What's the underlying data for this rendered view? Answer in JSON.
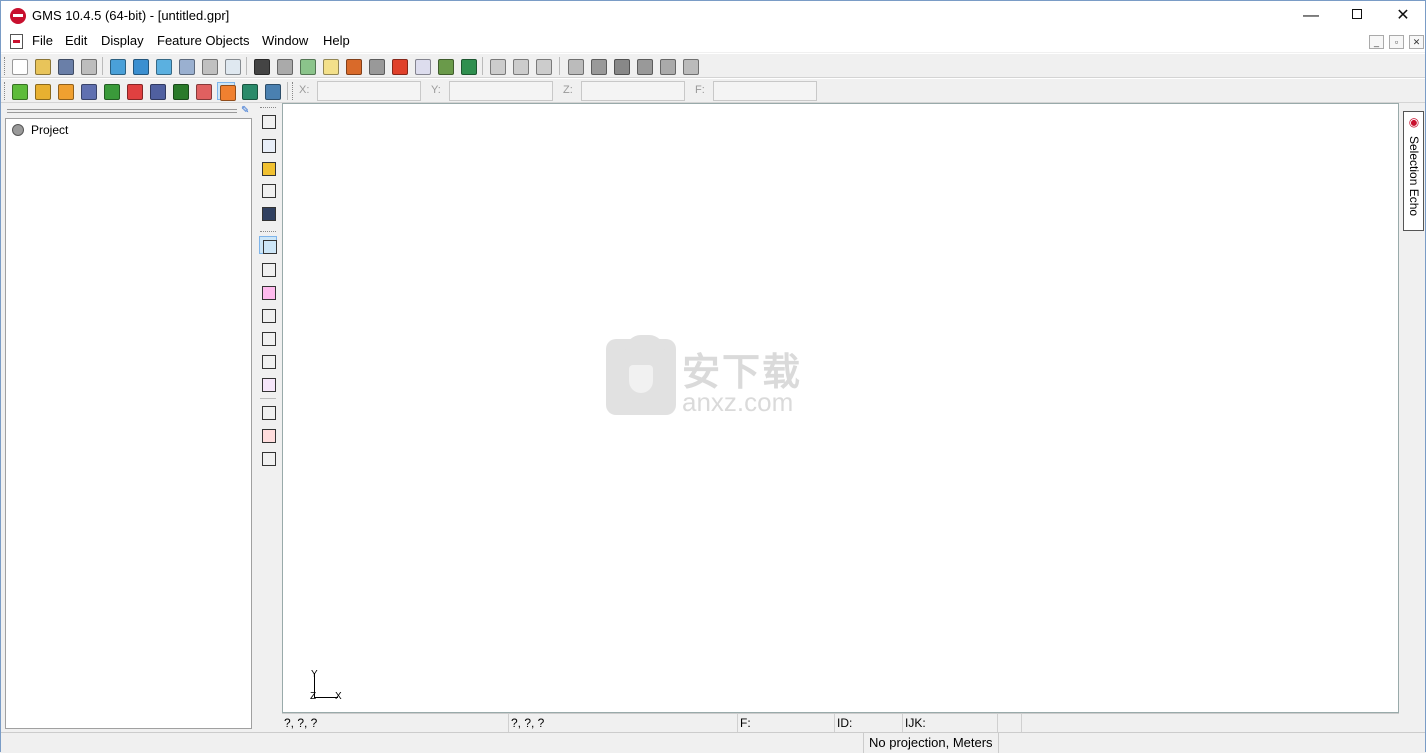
{
  "window": {
    "title": "GMS 10.4.5 (64-bit) - [untitled.gpr]"
  },
  "caption": {
    "minimize": "—",
    "maximize": "",
    "close": "✕"
  },
  "menu": {
    "items": [
      "File",
      "Edit",
      "Display",
      "Feature Objects",
      "Window",
      "Help"
    ]
  },
  "mdi": {
    "minimize": "_",
    "restore": "▫",
    "close": "✕"
  },
  "toolbar1": {
    "icons": [
      "new-file-icon",
      "open-folder-icon",
      "save-icon",
      "print-icon",
      "front-view-icon",
      "side-view-icon",
      "top-view-icon",
      "oblique-view-icon",
      "rotate-view-icon",
      "zoom-icon",
      "display-options-icon",
      "lock-icon",
      "refresh-icon",
      "light-icon",
      "chart-icon",
      "contour-icon",
      "color-ramp-icon",
      "spreadsheet-icon",
      "add-layers-icon",
      "globe-icon",
      "frame-icon",
      "frame-selected-icon",
      "frame-all-icon",
      "map-tool-icon",
      "map-coverage-icon",
      "map-feature-icon",
      "map-convert-icon",
      "map-grid-icon",
      "map-mesh-icon"
    ]
  },
  "toolbar2": {
    "icons": [
      "tin-module-icon",
      "borehole-module-icon",
      "solid-module-icon",
      "mesh-2d-module-icon",
      "grid-2d-module-icon",
      "scatter-2d-module-icon",
      "mesh-3d-module-icon",
      "grid-3d-module-icon",
      "scatter-3d-module-icon",
      "map-module-icon",
      "gis-module-icon",
      "uGrid-module-icon"
    ],
    "coords": [
      {
        "label": "X:",
        "value": ""
      },
      {
        "label": "Y:",
        "value": ""
      },
      {
        "label": "Z:",
        "value": ""
      },
      {
        "label": "F:",
        "value": ""
      }
    ]
  },
  "tree": {
    "root_label": "Project"
  },
  "tools": {
    "icons": [
      "pan-icon",
      "zoom-tool-icon",
      "rotate-tool-icon",
      "measure-icon",
      "frame-tool-icon",
      "select-arrow-icon",
      "select-point-icon",
      "select-node-icon",
      "select-arc-icon",
      "select-vertex-icon",
      "select-polygon-icon",
      "select-group-icon",
      "create-point-icon",
      "create-node-icon",
      "create-arc-icon"
    ]
  },
  "canvas": {
    "axis_y": "Y",
    "axis_x": "X",
    "axis_z": "Z",
    "watermark_cn": "安下载",
    "watermark_url": "anxz.com"
  },
  "echo": {
    "label": "Selection Echo"
  },
  "status": {
    "cells": [
      "?, ?, ?",
      "?, ?, ?",
      "F:",
      "ID:",
      "IJK:"
    ],
    "projection": "No projection, Meters"
  },
  "colors": {
    "accent": "#c8102e",
    "selection": "#cde6f7"
  }
}
